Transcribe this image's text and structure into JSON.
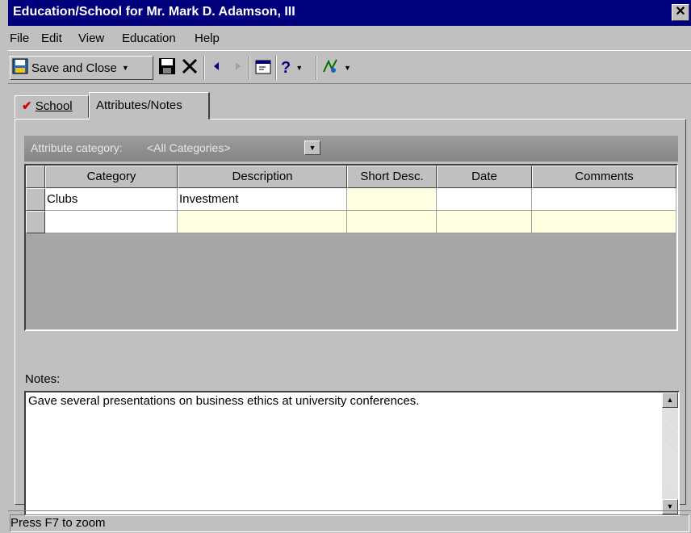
{
  "window": {
    "title": "Education/School for Mr. Mark D. Adamson, III"
  },
  "menu": [
    "File",
    "Edit",
    "View",
    "Education",
    "Help"
  ],
  "toolbar": {
    "save_close_label": "Save and Close",
    "icons": [
      "save-close-icon",
      "dropdown-arrow-icon",
      "save-disk-icon",
      "delete-x-icon",
      "previous-arrow-icon",
      "next-arrow-icon",
      "properties-icon",
      "help-icon",
      "dropdown-arrow-icon",
      "tools-icon",
      "dropdown-arrow-icon"
    ]
  },
  "tabs": [
    {
      "label": "School",
      "has_check": true
    },
    {
      "label": "Attributes/Notes",
      "active": true
    }
  ],
  "attribute_category": {
    "label": "Attribute category:",
    "value": "<All Categories>"
  },
  "grid": {
    "columns": [
      "Category",
      "Description",
      "Short Desc.",
      "Date",
      "Comments"
    ],
    "rows": [
      [
        "Clubs",
        "Investment",
        "",
        "",
        ""
      ],
      [
        "",
        "",
        "",
        "",
        ""
      ]
    ]
  },
  "notes": {
    "label": "Notes:",
    "value": "Gave several presentations on business ethics at university conferences."
  },
  "status": {
    "text": "Press F7 to zoom"
  },
  "colors": {
    "titlebar": "#00007c",
    "checkmark": "#d40000",
    "editable_cell": "#ffffe1"
  }
}
